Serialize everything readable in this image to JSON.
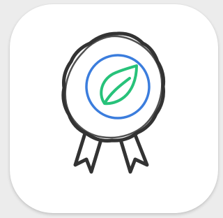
{
  "app_icon": {
    "icon": "award-ribbon-leaf-icon",
    "tile_color": "#ffffff",
    "background_color": "#ececec",
    "outline_color": "#333333",
    "ring_color": "#3b7ddd",
    "leaf_color": "#27c27a"
  }
}
